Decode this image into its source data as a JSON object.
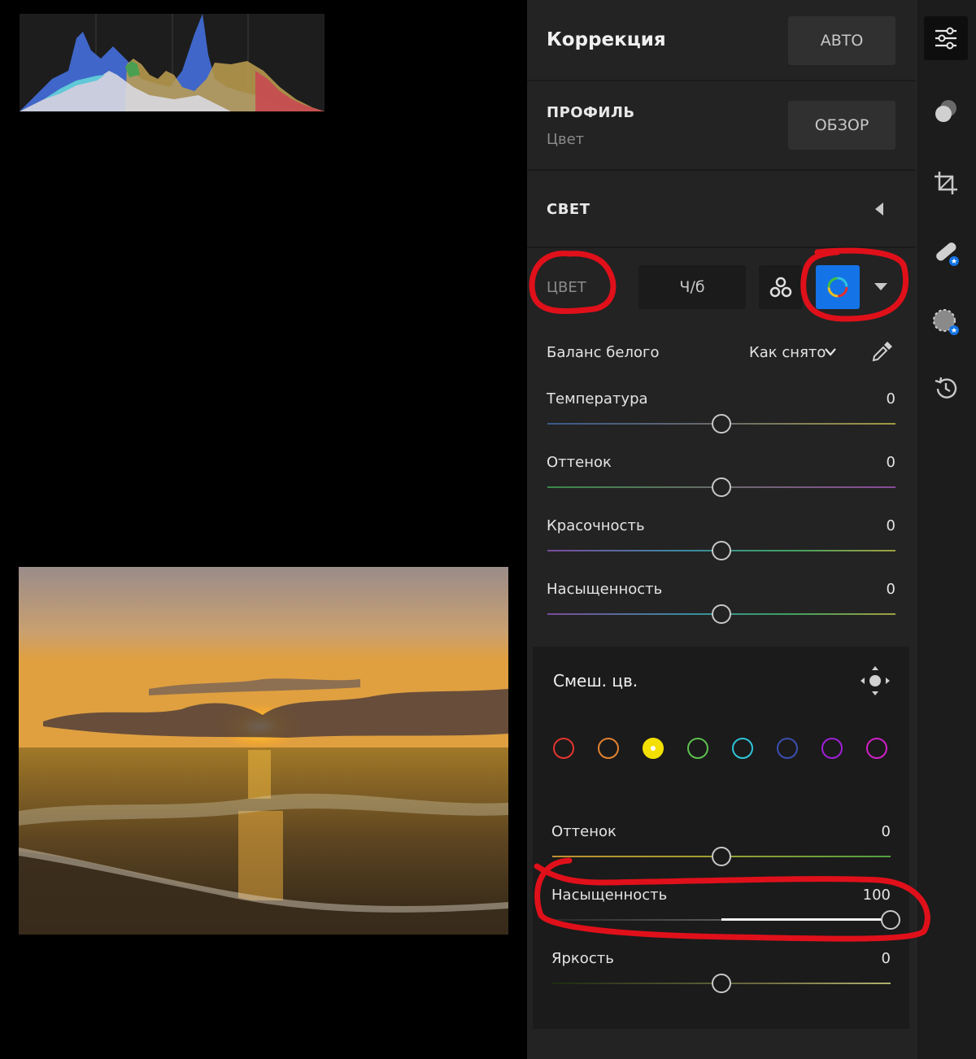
{
  "panel": {
    "title": "Коррекция",
    "auto_label": "АВТО",
    "profile": {
      "label": "ПРОФИЛЬ",
      "value": "Цвет",
      "browse_label": "ОБЗОР"
    },
    "light": {
      "label": "СВЕТ"
    },
    "color": {
      "label": "ЦВЕТ",
      "mode_label": "Ч/б",
      "white_balance": {
        "label": "Баланс белого",
        "value": "Как снято"
      },
      "sliders": [
        {
          "label": "Температура",
          "value": "0"
        },
        {
          "label": "Оттенок",
          "value": "0"
        },
        {
          "label": "Красочность",
          "value": "0"
        },
        {
          "label": "Насыщенность",
          "value": "0"
        }
      ]
    },
    "mixer": {
      "title": "Смеш. цв.",
      "swatches": [
        "#e3342f",
        "#e3822f",
        "#f3e000",
        "#5cc04e",
        "#2ec4d8",
        "#3b4fb0",
        "#a020d8",
        "#d020c8"
      ],
      "selected_index": 2,
      "sliders": [
        {
          "label": "Оттенок",
          "value": "0",
          "level": 0
        },
        {
          "label": "Насыщенность",
          "value": "100",
          "level": 100
        },
        {
          "label": "Яркость",
          "value": "0",
          "level": 0
        }
      ]
    }
  },
  "toolstrip": {
    "tools": [
      "sliders-icon",
      "color-mask-icon",
      "crop-icon",
      "healing-icon",
      "mask-icon",
      "history-icon"
    ],
    "active_tool": "sliders-icon"
  },
  "colors": {
    "accent": "#1473e6",
    "annotation": "#e0101a"
  }
}
